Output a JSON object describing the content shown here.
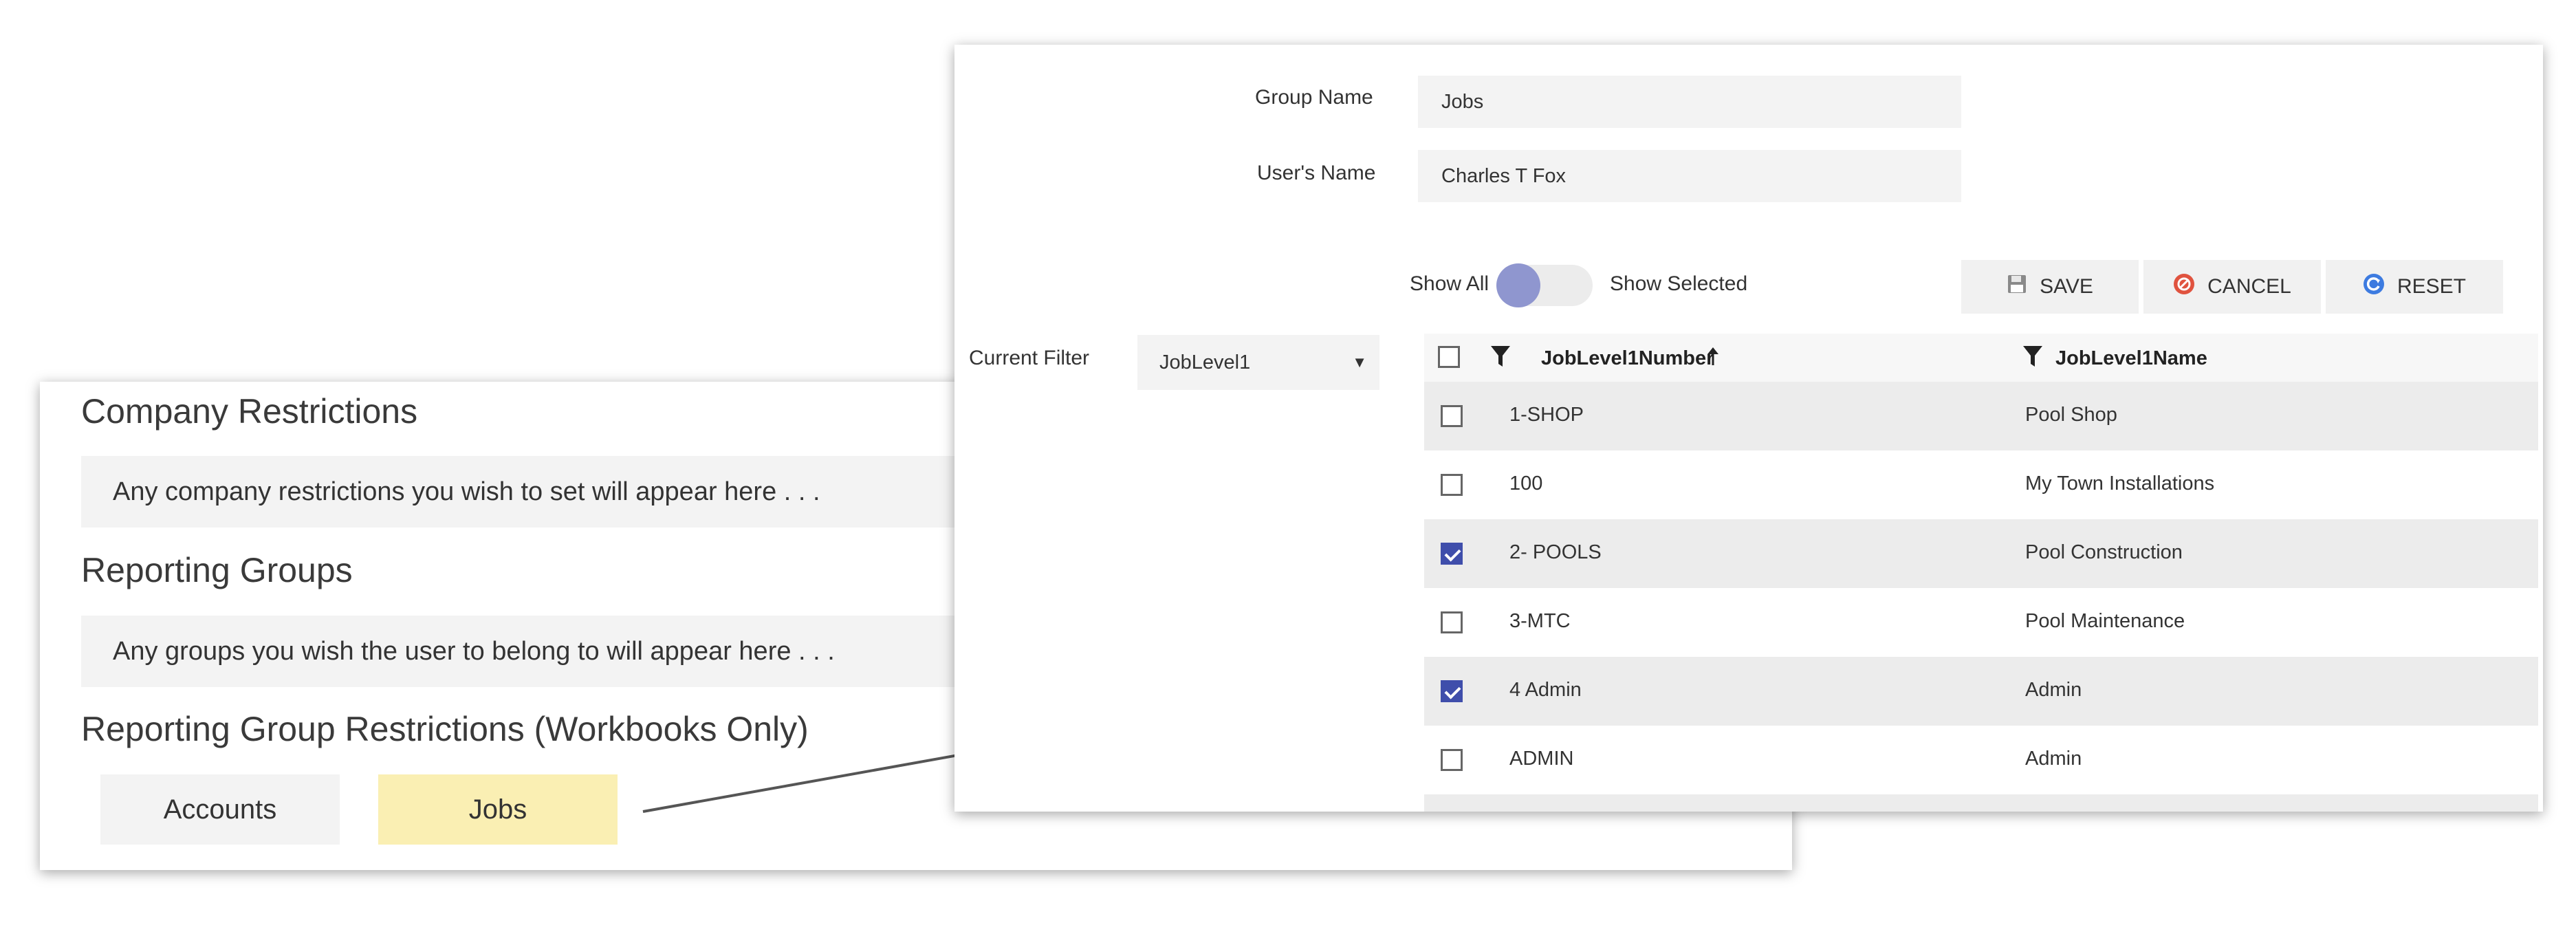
{
  "left_panel": {
    "company_restrictions": {
      "title": "Company Restrictions",
      "placeholder": "Any company restrictions you wish to set will appear here . . ."
    },
    "reporting_groups": {
      "title": "Reporting Groups",
      "placeholder": "Any groups you wish the user to belong to will appear here . . ."
    },
    "group_restrictions": {
      "title": "Reporting Group Restrictions (Workbooks Only)",
      "buttons": [
        {
          "label": "Accounts",
          "selected": false,
          "color": "#f3f3f3"
        },
        {
          "label": "Jobs",
          "selected": true,
          "color": "#faefb3"
        }
      ]
    }
  },
  "editor": {
    "group_name": {
      "label": "Group Name",
      "value": "Jobs"
    },
    "users_name": {
      "label": "User's Name",
      "value": "Charles T Fox"
    },
    "toggle": {
      "left_label": "Show All",
      "right_label": "Show Selected",
      "state": "show_all"
    },
    "actions": {
      "save": {
        "label": "SAVE",
        "icon": "floppy-disk-icon"
      },
      "cancel": {
        "label": "CANCEL",
        "icon": "cancel-icon"
      },
      "reset": {
        "label": "RESET",
        "icon": "refresh-icon"
      }
    },
    "current_filter": {
      "label": "Current Filter",
      "selected": "JobLevel1"
    },
    "grid": {
      "columns": [
        {
          "label": "JobLevel1Number",
          "sort": "ascending"
        },
        {
          "label": "JobLevel1Name"
        }
      ],
      "rows": [
        {
          "number": "1-SHOP",
          "name": "Pool Shop",
          "checked": false
        },
        {
          "number": "100",
          "name": "My Town Installations",
          "checked": false
        },
        {
          "number": "2- POOLS",
          "name": "Pool Construction",
          "checked": true
        },
        {
          "number": "3-MTC",
          "name": "Pool Maintenance",
          "checked": false
        },
        {
          "number": "4 Admin",
          "name": "Admin",
          "checked": true
        },
        {
          "number": "ADMIN",
          "name": "Admin",
          "checked": false
        }
      ]
    }
  },
  "colors": {
    "accent": "#3f4eab",
    "toggle_knob": "#8f96cf",
    "selected_group": "#faefb3",
    "cancel_icon": "#e0533f",
    "reset_icon": "#3d7be0"
  }
}
